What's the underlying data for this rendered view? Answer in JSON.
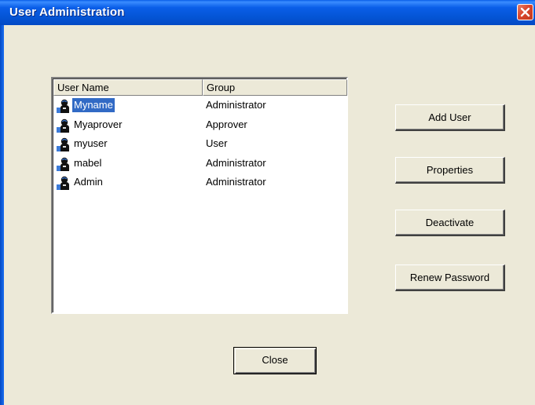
{
  "window": {
    "title": "User Administration"
  },
  "list": {
    "columns": [
      "User Name",
      "Group"
    ],
    "rows": [
      {
        "name": "Myname",
        "group": "Administrator",
        "selected": true,
        "icon": "user-icon"
      },
      {
        "name": "Myaprover",
        "group": "Approver",
        "selected": false,
        "icon": "user-icon"
      },
      {
        "name": "myuser",
        "group": "User",
        "selected": false,
        "icon": "user-icon"
      },
      {
        "name": "mabel",
        "group": "Administrator",
        "selected": false,
        "icon": "user-icon"
      },
      {
        "name": "Admin",
        "group": "Administrator",
        "selected": false,
        "icon": "user-icon"
      }
    ]
  },
  "buttons": {
    "add_user": "Add User",
    "properties": "Properties",
    "deactivate": "Deactivate",
    "renew_password": "Renew Password",
    "close": "Close"
  },
  "colors": {
    "title_bar": "#0a5ee8",
    "selection": "#316ac5",
    "dialog_bg": "#ece9d8",
    "close_button": "#d9452c"
  }
}
